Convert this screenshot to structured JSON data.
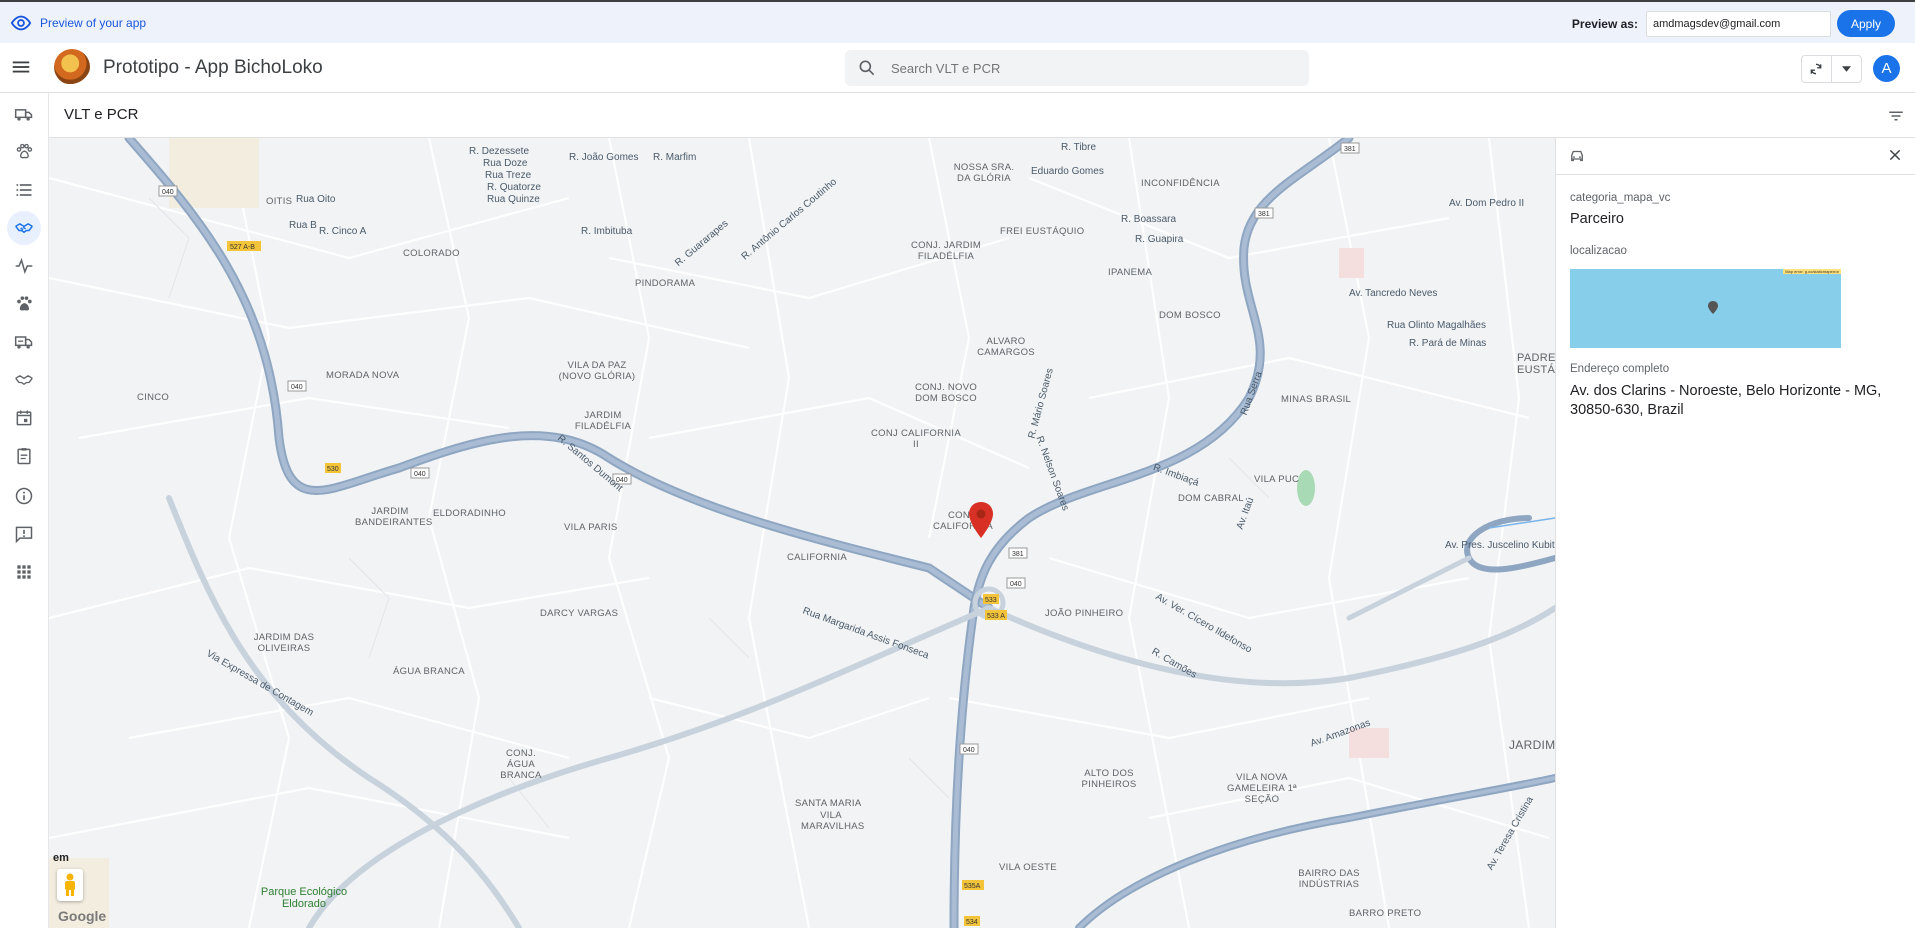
{
  "preview_bar": {
    "label": "Preview of your app",
    "preview_as_label": "Preview as:",
    "email": "amdmagsdev@gmail.com",
    "apply_label": "Apply"
  },
  "header": {
    "app_title": "Prototipo - App BichoLoko",
    "search_placeholder": "Search VLT e PCR",
    "avatar_letter": "A"
  },
  "sidebar": {
    "items": [
      {
        "icon": "truck-icon"
      },
      {
        "icon": "paw-icon"
      },
      {
        "icon": "list-icon"
      },
      {
        "icon": "handshake-icon",
        "active": true
      },
      {
        "icon": "activity-icon"
      },
      {
        "icon": "pets-icon"
      },
      {
        "icon": "delivery-truck-icon"
      },
      {
        "icon": "handshake-outline-icon"
      },
      {
        "icon": "calendar-icon"
      },
      {
        "icon": "clipboard-icon"
      },
      {
        "icon": "info-icon"
      },
      {
        "icon": "feedback-icon"
      },
      {
        "icon": "apps-icon"
      }
    ]
  },
  "view": {
    "title": "VLT e PCR"
  },
  "map": {
    "labels": [
      "R. Dezessete",
      "Rua Doze",
      "Rua Treze",
      "R. Quatorze",
      "Rua Quinze",
      "Rua Oito",
      "R. Cinco A",
      "Rua B",
      "OITIS",
      "R. João Gomes",
      "R. Marfim",
      "R. Tibre",
      "NOSSA SRA. DA GLÓRIA",
      "Eduardo Gomes",
      "INCONFIDÊNCIA",
      "Av. Dom Pedro II",
      "Av. Tancredo Neves",
      "Rua Olinto Magalhães",
      "R. Pará de Minas",
      "PADRE EUSTÁQUIO",
      "MINAS BRASIL",
      "COLORADO",
      "PINDORAMA",
      "FREI EUSTÁQUIO",
      "IPANEMA",
      "DOM BOSCO",
      "CONJ. JARDIM FILADÉLFIA",
      "R. Boassara",
      "R. Guapira",
      "R. Imbituba",
      "R. Guararapes",
      "R. Antônio Carlos Coutinho",
      "MORADA NOVA",
      "CINCO",
      "VILA DA PAZ (NOVO GLÓRIA)",
      "JARDIM FILADÉLFIA",
      "ALVARO CAMARGOS",
      "CONJ. NOVO DOM BOSCO",
      "CONJ CALIFORNIA II",
      "CONJ. CALIFORNIA",
      "CALIFORNIA",
      "JARDIM BANDEIRANTES",
      "ELDORADINHO",
      "VILA PARIS",
      "DOM CABRAL",
      "VILA PUC",
      "R. Imbiaçá",
      "Av. Pres. Juscelino Kubitschek",
      "Av. Amazonas",
      "JOÃO PINHEIRO",
      "DARCY VARGAS",
      "JARDIM DAS OLIVEIRAS",
      "ÁGUA BRANCA",
      "CONJ. ÁGUA BRANCA",
      "Via Expressa de Contagem",
      "SANTA MARIA",
      "VILA MARAVILHAS",
      "ALTO DOS PINHEIROS",
      "VILA NOVA GAMELEIRA 1ª SEÇÃO",
      "BAIRRO DAS INDÚSTRIAS",
      "BARRO PRETO",
      "VILA OESTE",
      "JARDIM AMÉRICA",
      "Parque Ecológico Eldorado",
      "Av. Teresa Cristina",
      "Av. Ver. Cícero Ildefonso",
      "Rua Margarida Assis Fonseca",
      "R. Santos Dumont",
      "R. Camões",
      "Rua Serra",
      "Av. Itaú",
      "R. Mário Soares",
      "R. Nelson Soares",
      "040",
      "381",
      "527 A-B",
      "530",
      "533",
      "533 A",
      "535A",
      "534"
    ],
    "streetview_label": "em",
    "attribution": "Google"
  },
  "detail_panel": {
    "field1_label": "categoria_mapa_vc",
    "field1_value": "Parceiro",
    "field2_label": "localizacao",
    "minimap_tag": "Map error: g.co/staticmaperror",
    "field3_label": "Endereço completo",
    "field3_value": "Av. dos Clarins - Noroeste, Belo Horizonte - MG, 30850-630, Brazil"
  },
  "colors": {
    "accent": "#1a73e8",
    "major_road": "#8fa6c2",
    "map_bg": "#f1f3f4",
    "marker": "#d93025",
    "park": "#a8dab5",
    "minimap": "#87ceeb"
  }
}
